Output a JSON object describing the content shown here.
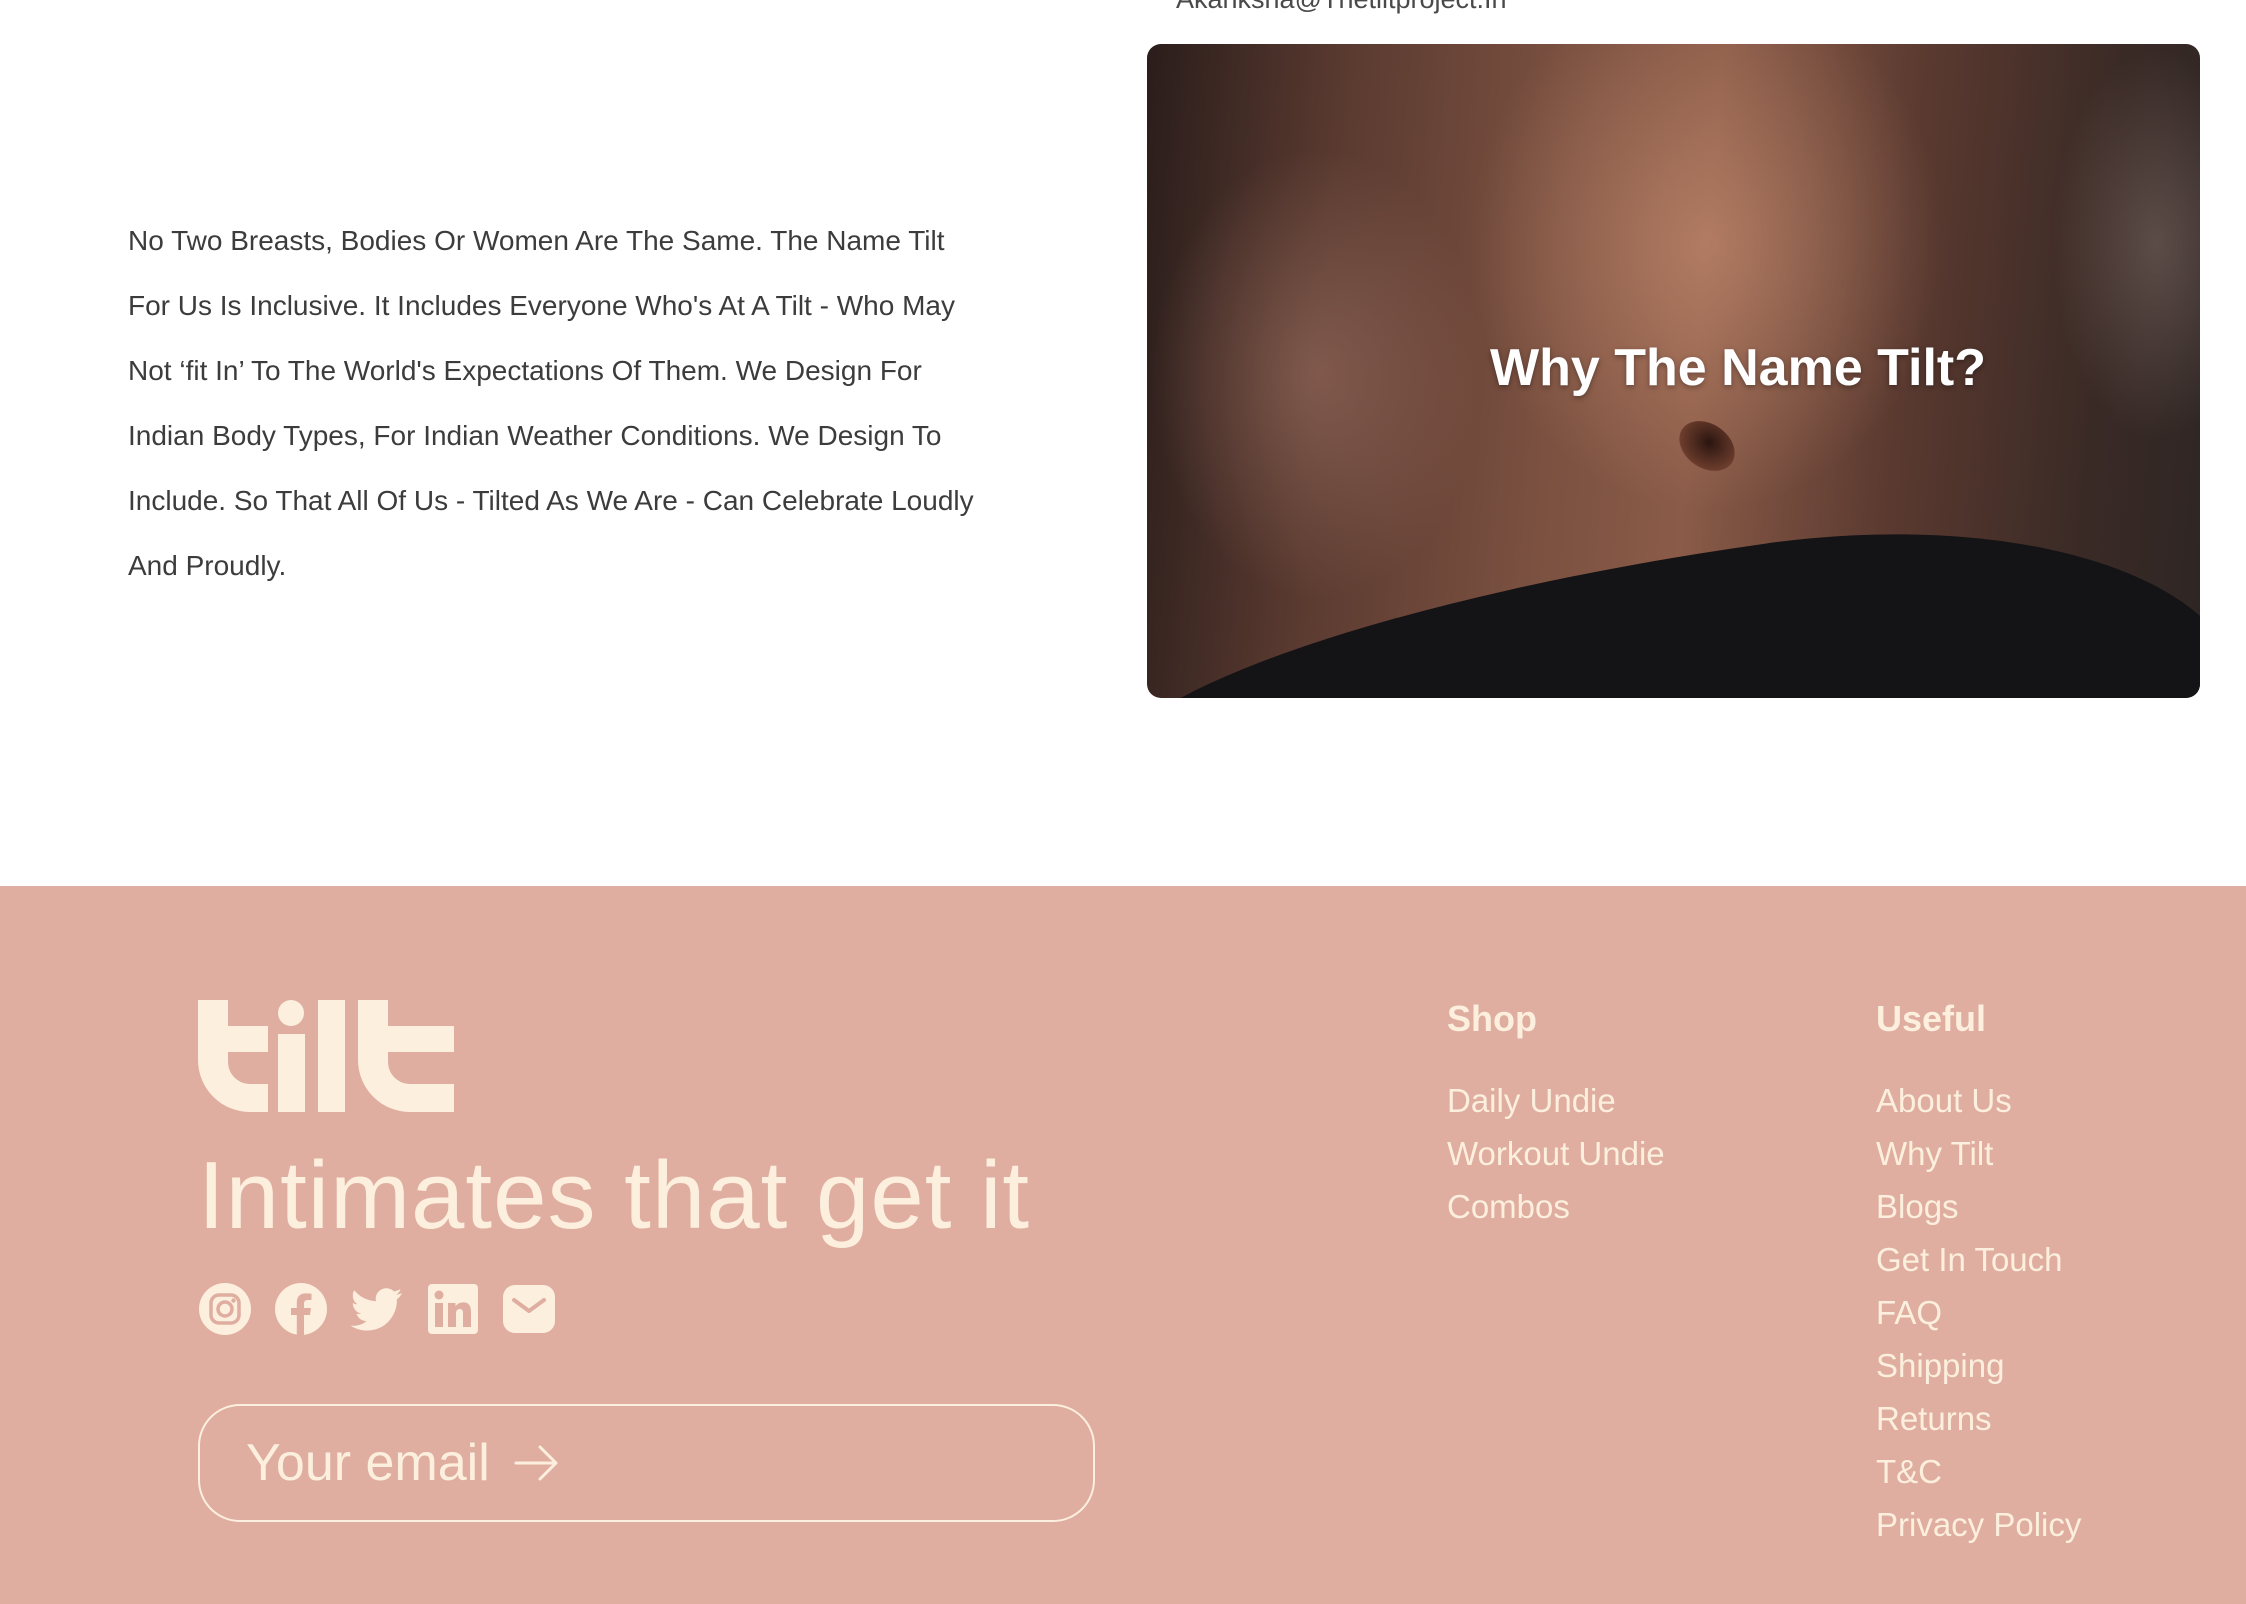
{
  "contact": {
    "email": "Akanksha@Thetiltproject.In"
  },
  "intro": {
    "lines": [
      "No Two Breasts, Bodies Or Women Are The Same. The Name Tilt",
      "For Us Is Inclusive. It Includes Everyone Who's At A Tilt - Who May",
      "Not ‘fit In’ To The World's Expectations Of Them. We Design For",
      "Indian Body Types, For Indian Weather Conditions. We Design To",
      "Include. So That All Of Us - Tilted As We Are - Can Celebrate Loudly",
      "And Proudly."
    ]
  },
  "hero": {
    "title": "Why The Name Tilt?"
  },
  "footer": {
    "brand": "tilt",
    "tagline": "Intimates that get it",
    "social": [
      "instagram-icon",
      "facebook-icon",
      "twitter-icon",
      "linkedin-icon",
      "mail-icon"
    ],
    "email_placeholder": "Your email",
    "shop": {
      "heading": "Shop",
      "links": [
        "Daily Undie",
        "Workout Undie",
        "Combos"
      ]
    },
    "useful": {
      "heading": "Useful",
      "links": [
        "About Us",
        "Why Tilt",
        "Blogs",
        "Get In Touch",
        "FAQ",
        "Shipping",
        "Returns",
        "T&C",
        "Privacy Policy"
      ]
    }
  },
  "colors": {
    "footer_bg": "#dfaea0",
    "footer_text": "#fcefdd",
    "body_text": "#3c3c3c"
  }
}
